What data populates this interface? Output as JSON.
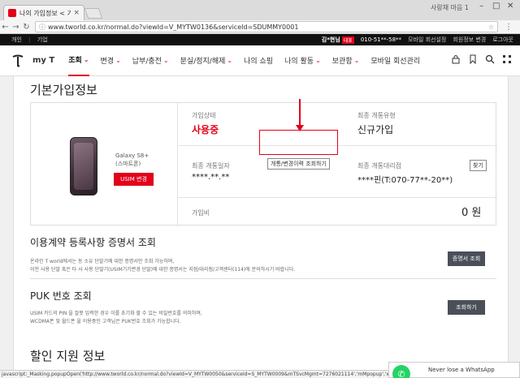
{
  "browser": {
    "tab_title": "나의 가입정보 < 기본정",
    "tab_close": "×",
    "window_user": "사랑채 마음 1",
    "url": "www.tworld.co.kr/normal.do?viewId=V_MYTW0136&serviceId=SDUMMY0001"
  },
  "topstrip": {
    "personal": "개인",
    "corporate": "기업",
    "user_name": "김*현님",
    "user_badge": "대표",
    "phone": "010-51**-58**",
    "links": [
      "모바일 회선설정",
      "회원정보 변경",
      "로그아웃"
    ]
  },
  "gnb": {
    "myt": "my T",
    "items": [
      {
        "label": "조회",
        "chevron": true,
        "active": true
      },
      {
        "label": "변경",
        "chevron": true
      },
      {
        "label": "납부/충전",
        "chevron": true
      },
      {
        "label": "분실/정지/해제",
        "chevron": true
      },
      {
        "label": "나의 쇼핑",
        "chevron": false
      },
      {
        "label": "나의 활동",
        "chevron": true
      },
      {
        "label": "보관함",
        "chevron": true
      },
      {
        "label": "모바일 회선관리",
        "chevron": false
      }
    ]
  },
  "basic_info": {
    "title": "기본가입정보",
    "model_line1": "Galaxy S8+",
    "model_line2": "(스마트폰)",
    "usim_button": "USIM 변경",
    "status_label": "가입상태",
    "status_value": "사용중",
    "latest_type_label": "최종 개통유형",
    "latest_type_value": "신규가입",
    "open_date_label": "최종 개통일자",
    "open_date_value": "****.**.**",
    "history_button": "개통/변경이력 조회하기",
    "agency_label": "최종 개통대리점",
    "agency_value": "****핀(T:070-77**-20**)",
    "find_button": "찾기",
    "join_fee_label": "가입비",
    "join_fee_value": "0 원"
  },
  "certificate": {
    "title": "이용계약 등록사항 증명서 조회",
    "desc_line1": "온라인 T world에서는 등 소유 단말기에 대한 증명서만 조회 가능하며,",
    "desc_line2": "이전 사용 단말 혹은 타 사 사용 단말기(USIM기기변경 단말)에 대한 증명서는 지점/대리점/고객센터(114)에 문의하시기 바랍니다.",
    "button": "증명서 조회"
  },
  "puk": {
    "title": "PUK 번호 조회",
    "desc_line1": "USIM 카드의 PIN 을 잘못 입력한 경우 이를 초기화 할 수 있는 비밀번호를 의미하며,",
    "desc_line2": "WCDMA폰 및 월드폰 을 이용중인 고객님은 PUK번호 조회가 가능합니다.",
    "button": "조회하기"
  },
  "discount": {
    "title": "할인 지원 정보"
  },
  "statusbar": {
    "text": "javascript:_Masking.popupOpen('http://www.tworld.co.kr/normal.do?viewId=V_MYTW0050&serviceId=S_MYTW0009&mTSvcMgmt=7276021114','mMpopup','width=1000p"
  },
  "toast": {
    "text": "Never lose a WhatsApp"
  },
  "colors": {
    "brand_red": "#e2001a",
    "dark_button": "#4a4f58"
  }
}
